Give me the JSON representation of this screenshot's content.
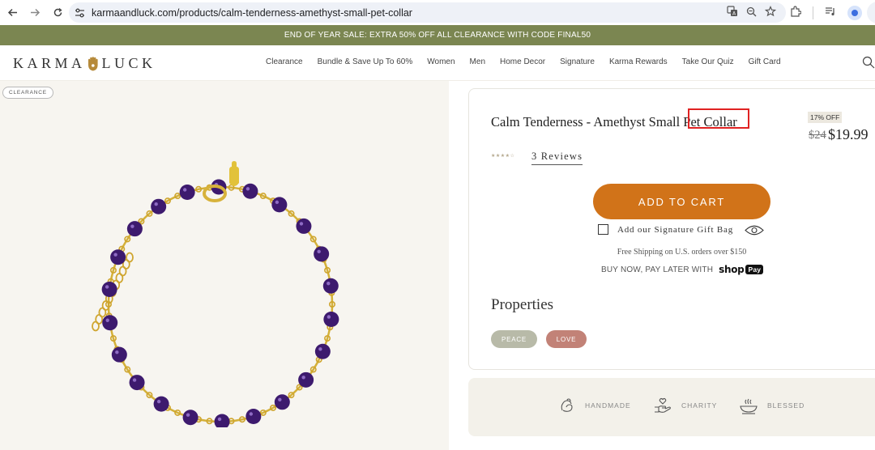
{
  "browser": {
    "url": "karmaandluck.com/products/calm-tenderness-amethyst-small-pet-collar",
    "icons": [
      "back-icon",
      "forward-icon",
      "reload-icon",
      "site-info-icon",
      "translate-icon",
      "zoom-icon",
      "bookmark-star-icon",
      "extensions-icon",
      "media-icon",
      "profile-icon"
    ]
  },
  "announcement": {
    "text": "END OF YEAR SALE: EXTRA 50% OFF ALL CLEARANCE WITH CODE FINAL50",
    "background": "#7b8651"
  },
  "header": {
    "logo_left": "KARMA",
    "logo_right": "LUCK",
    "nav": [
      "Clearance",
      "Bundle & Save Up To 60%",
      "Women",
      "Men",
      "Home Decor",
      "Signature",
      "Karma Rewards",
      "Take Our Quiz",
      "Gift Card"
    ]
  },
  "image_panel": {
    "badge": "CLEARANCE"
  },
  "product": {
    "title": "Calm Tenderness - Amethyst Small Pet Collar",
    "discount_badge": "17% OFF",
    "price_old": "$24",
    "price_new": "$19.99",
    "rating": 4,
    "reviews_label": "3 Reviews",
    "add_to_cart": "ADD TO CART",
    "gift_bag_label": "Add our Signature Gift Bag",
    "gift_bag_checked": false,
    "shipping_note": "Free Shipping on U.S. orders over $150",
    "pay_later": "BUY NOW, PAY LATER WITH",
    "shop_pay_logo": "shop",
    "shop_pay_badge": "Pay",
    "accent_color": "#d17319",
    "properties_title": "Properties",
    "properties": [
      "PEACE",
      "LOVE"
    ]
  },
  "values": [
    "HANDMADE",
    "CHARITY",
    "BLESSED"
  ]
}
